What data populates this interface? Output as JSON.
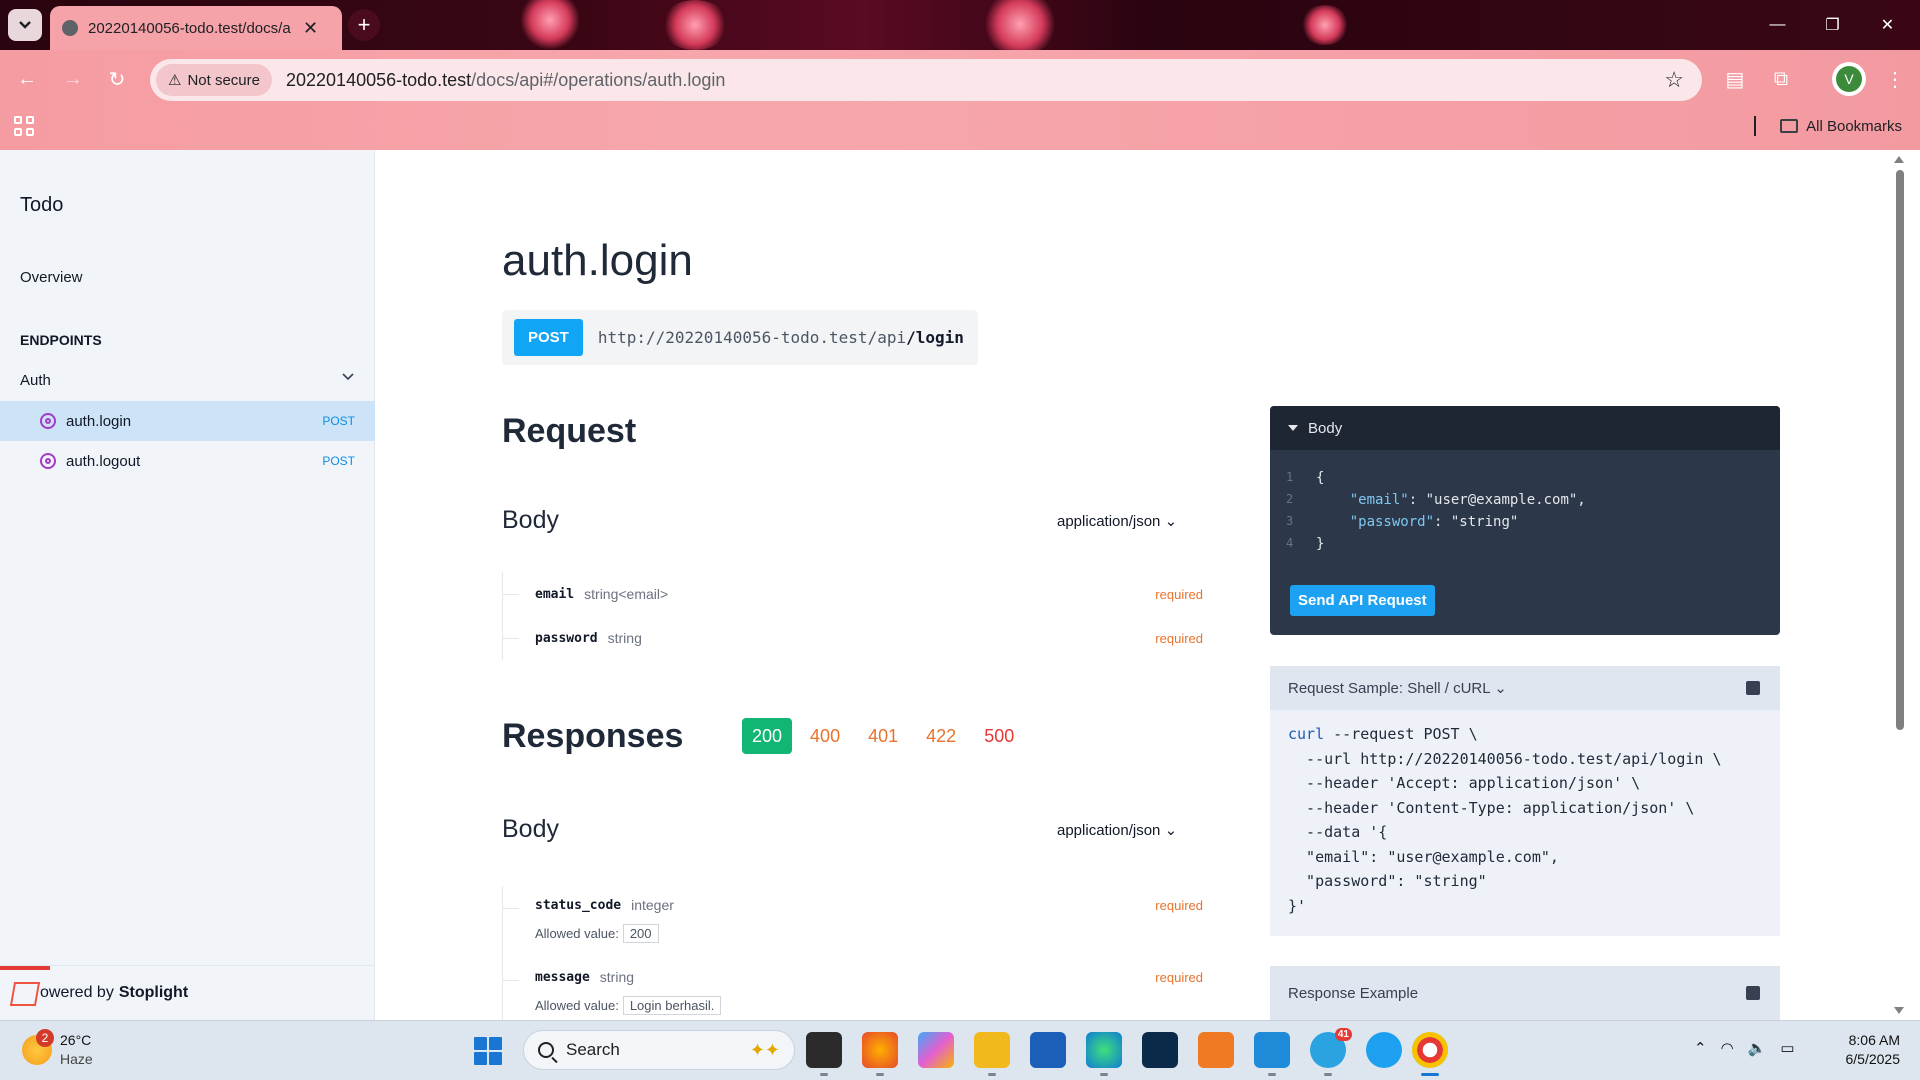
{
  "browser": {
    "tab_title": "20220140056-todo.test/docs/a",
    "security_label": "Not secure",
    "url_host": "20220140056-todo.test",
    "url_path": "/docs/api#/operations/auth.login",
    "profile_initial": "V",
    "all_bookmarks": "All Bookmarks"
  },
  "sidebar": {
    "title": "Todo",
    "overview": "Overview",
    "endpoints_heading": "ENDPOINTS",
    "group": "Auth",
    "items": [
      {
        "label": "auth.login",
        "method": "POST"
      },
      {
        "label": "auth.logout",
        "method": "POST"
      }
    ],
    "footer_prefix": "owered by",
    "footer_brand": "Stoplight"
  },
  "main": {
    "title": "auth.login",
    "method": "POST",
    "url_base": "http://20220140056-todo.test/api",
    "url_path": "/login",
    "request_heading": "Request",
    "body_heading": "Body",
    "content_type": "application/json",
    "request_fields": [
      {
        "name": "email",
        "type": "string<email>",
        "required": "required"
      },
      {
        "name": "password",
        "type": "string",
        "required": "required"
      }
    ],
    "responses_heading": "Responses",
    "response_codes": [
      "200",
      "400",
      "401",
      "422",
      "500"
    ],
    "response_body_heading": "Body",
    "response_content_type": "application/json",
    "response_fields": [
      {
        "name": "status_code",
        "type": "integer",
        "required": "required",
        "allowed_label": "Allowed value:",
        "allowed_value": "200"
      },
      {
        "name": "message",
        "type": "string",
        "required": "required",
        "allowed_label": "Allowed value:",
        "allowed_value": "Login berhasil."
      }
    ]
  },
  "try_panel": {
    "header": "Body",
    "lines": [
      {
        "n": "1",
        "text": "{"
      },
      {
        "n": "2",
        "key": "\"email\"",
        "text": ": \"user@example.com\","
      },
      {
        "n": "3",
        "key": "\"password\"",
        "text": ": \"string\""
      },
      {
        "n": "4",
        "text": "}"
      }
    ],
    "send_button": "Send API Request"
  },
  "sample_panel": {
    "header": "Request Sample: Shell / cURL",
    "code_cmd": "curl",
    "code_rest": " --request POST \\\n  --url http://20220140056-todo.test/api/login \\\n  --header 'Accept: application/json' \\\n  --header 'Content-Type: application/json' \\\n  --data '{\n  \"email\": \"user@example.com\",\n  \"password\": \"string\"\n}'"
  },
  "response_example": {
    "header": "Response Example"
  },
  "taskbar": {
    "weather_temp": "26°C",
    "weather_desc": "Haze",
    "weather_badge": "2",
    "search_placeholder": "Search",
    "telegram_badge": "41",
    "time": "8:06 AM",
    "date": "6/5/2025"
  },
  "colors": {
    "accent": "#10a5f5",
    "success": "#11b674",
    "warning": "#e8732c",
    "error": "#e53935",
    "panel_dark": "#2c3849"
  }
}
